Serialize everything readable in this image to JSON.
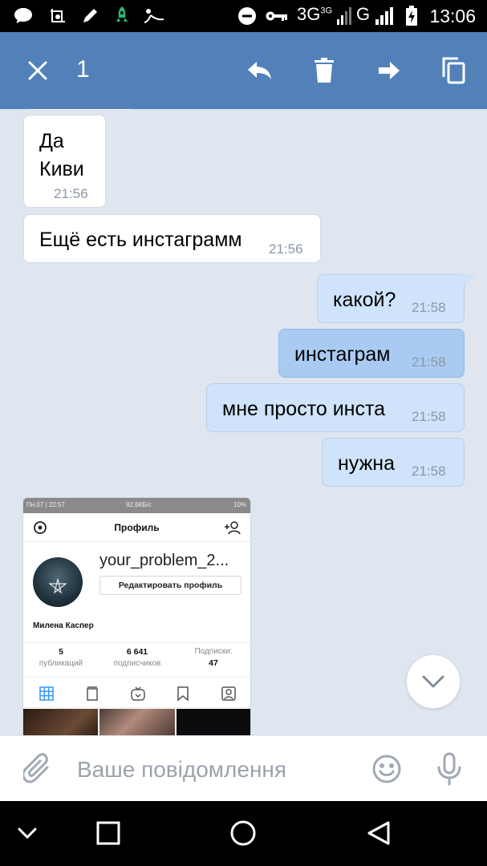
{
  "status_bar": {
    "time": "13:06",
    "network_1": "3G",
    "network_1_sup": "3G",
    "network_2": "G",
    "icons": [
      "chat-bubble-icon",
      "screenshot-icon",
      "pen-icon",
      "rocket-icon",
      "app-icon",
      "dnd-icon",
      "key-icon",
      "signal-icon",
      "battery-charging-icon"
    ]
  },
  "action_bar": {
    "selected_count": "1",
    "icons": [
      "close-icon",
      "reply-icon",
      "delete-icon",
      "forward-icon",
      "copy-icon"
    ]
  },
  "messages": [
    {
      "direction": "in",
      "text_line1": "Да",
      "text_line2": "Киви",
      "time": "21:56"
    },
    {
      "direction": "in",
      "text": "Ещё есть инстаграмм",
      "time": "21:56"
    },
    {
      "direction": "out",
      "text": "какой?",
      "time": "21:58"
    },
    {
      "direction": "out",
      "text": "инстаграм",
      "time": "21:58",
      "selected": true
    },
    {
      "direction": "out",
      "text": "мне просто инста",
      "time": "21:58"
    },
    {
      "direction": "out",
      "text": "нужна",
      "time": "21:58"
    }
  ],
  "attachment": {
    "status_left": "Пн,07 | 22:57",
    "status_right": "92,6КБ/с",
    "status_battery": "10%",
    "title": "Профиль",
    "username": "your_problem_2...",
    "edit_button": "Редактировать профиль",
    "name": "Милена Каспер",
    "stats": [
      {
        "value": "5",
        "label": "публикаций"
      },
      {
        "value": "6 641",
        "label": "подписчиков"
      },
      {
        "value": "47",
        "label": "Подписки:"
      }
    ]
  },
  "composer": {
    "placeholder": "Ваше повідомлення"
  }
}
